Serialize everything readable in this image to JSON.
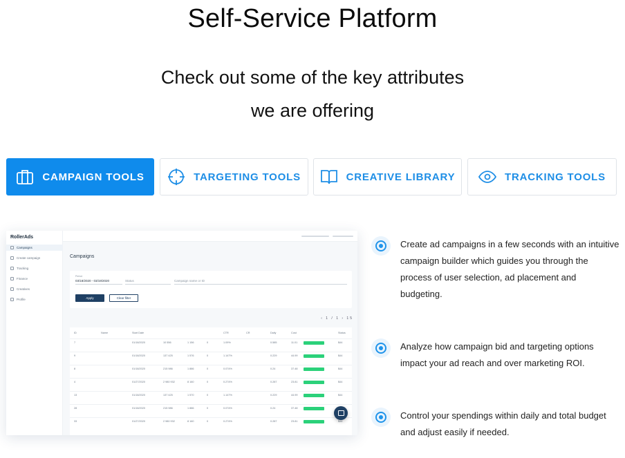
{
  "header": {
    "title": "Self-Service Platform",
    "subtitle_line1": "Check out some of the key attributes",
    "subtitle_line2": "we are offering"
  },
  "tabs": [
    {
      "label": "CAMPAIGN TOOLS",
      "icon": "briefcase-icon",
      "active": true
    },
    {
      "label": "TARGETING TOOLS",
      "icon": "crosshair-icon",
      "active": false
    },
    {
      "label": "CREATIVE LIBRARY",
      "icon": "book-icon",
      "active": false
    },
    {
      "label": "TRACKING TOOLS",
      "icon": "eye-icon",
      "active": false
    }
  ],
  "colors": {
    "accent": "#0f8bec",
    "tab_text": "#1e8ee6",
    "bullet": "#1e93ea"
  },
  "screenshot": {
    "logo": "RollerAds",
    "sidebar": [
      "Campaigns",
      "Create campaign",
      "Tracking",
      "Finance",
      "Creatives",
      "Profile"
    ],
    "page_title": "Campaigns",
    "filter": {
      "date_label": "Period",
      "date_value": "03/18/2020 - 03/19/2020",
      "status_placeholder": "Status",
      "search_placeholder": "Campaign name or ID",
      "apply_label": "Apply",
      "clear_label": "Clear filter"
    },
    "pager": "‹ 1 / 1 › 15",
    "columns": [
      "ID",
      "Name",
      "Start Date",
      "",
      "",
      "",
      "CTR",
      "CR",
      "Daily",
      "Cost",
      "Status",
      ""
    ],
    "rows": [
      [
        "7",
        "01/18/2020",
        "10 556",
        "1 156",
        "0",
        "1.09%",
        "0.585",
        "11.01",
        "$44"
      ],
      [
        "9",
        "01/18/2020",
        "137 425",
        "1 576",
        "0",
        "1.147%",
        "0.229",
        "44.99",
        "$44"
      ],
      [
        "8",
        "01/18/2020",
        "215 986",
        "1 886",
        "0",
        "0.074%",
        "0.24",
        "37.48",
        "$44"
      ],
      [
        "4",
        "01/27/2020",
        "2 980 932",
        "8 160",
        "0",
        "0.274%",
        "0.287",
        "23.81",
        "$44"
      ],
      [
        "13",
        "01/18/2020",
        "137 425",
        "1 570",
        "0",
        "1.147%",
        "0.229",
        "44.99",
        "$44"
      ],
      [
        "28",
        "01/18/2020",
        "215 986",
        "1 886",
        "0",
        "0.074%",
        "0.24",
        "37.48",
        "$44"
      ],
      [
        "33",
        "01/27/2020",
        "2 980 932",
        "8 160",
        "0",
        "0.274%",
        "0.287",
        "23.81",
        "$44"
      ]
    ]
  },
  "features": [
    "Create ad campaigns in a few seconds with an intuitive campaign builder which guides you through the process of user selection, ad placement and budgeting.",
    "Analyze how campaign bid and targeting options impact your ad reach and over marketing ROI.",
    "Control your spendings within daily and total budget and adjust easily if needed."
  ]
}
